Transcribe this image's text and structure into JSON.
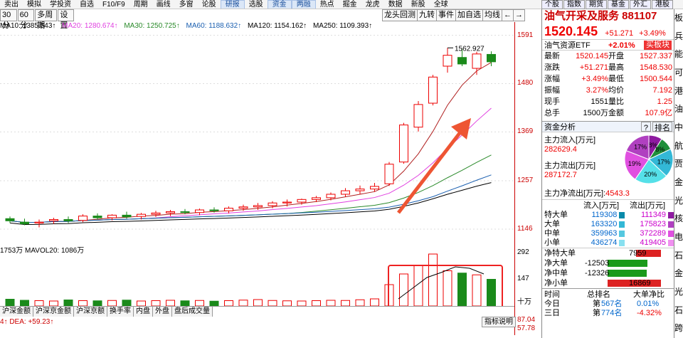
{
  "menu": [
    "卖出",
    "模拟",
    "学投资",
    "自选",
    "F10/F9",
    "周期",
    "画线",
    "多窗",
    "论股",
    "研报",
    "选股",
    "资金",
    "两融",
    "热点",
    "掘金",
    "龙虎",
    "数据",
    "新股",
    "全球"
  ],
  "menu_highlight": [
    "研报",
    "资金",
    "两融"
  ],
  "right_top_tabs": [
    "个股",
    "指数",
    "期货",
    "基金",
    "外汇",
    "港股"
  ],
  "period_tabs": [
    "30分",
    "60分",
    "多周期",
    "设置"
  ],
  "right_tools": [
    "龙头回测",
    "九转",
    "事件",
    "加自选",
    "均线",
    "←",
    "→"
  ],
  "ma": {
    "ma10": "MA10: 1385.543↑",
    "ma20": "MA20: 1280.674↑",
    "ma30": "MA30: 1250.725↑",
    "ma60": "MA60: 1188.632↑",
    "ma120": "MA120: 1154.162↑",
    "ma250": "MA250: 1109.393↑"
  },
  "price_ticks": [
    "1591",
    "1480",
    "1369",
    "1257",
    "1146"
  ],
  "high_label": "1562.927",
  "vol_header": "1753万  MAVOL20: 1086万",
  "vol_ticks": [
    "292",
    "147",
    "十万"
  ],
  "bottom_tabs": [
    "沪深金额",
    "沪深京金额",
    "沪深京额",
    "换手率",
    "内盘",
    "外盘",
    "盘后成交量"
  ],
  "macd_header": "4↑ DEA: +59.23↑",
  "macd_ticks": [
    "87.04",
    "57.78"
  ],
  "zb_btn": "指标说明",
  "stock": {
    "name": "油气开采及服务 881107",
    "price": "1520.145",
    "change": "+51.271",
    "pct": "+3.49%",
    "etf": "油气资源ETF",
    "etf_pct": "+2.01%",
    "buy": "买板块"
  },
  "quote": [
    {
      "k1": "最新",
      "v1": "1520.145",
      "k2": "开盘",
      "v2": "1527.337"
    },
    {
      "k1": "涨跌",
      "v1": "+51.271",
      "k2": "最高",
      "v2": "1548.530"
    },
    {
      "k1": "涨幅",
      "v1": "+3.49%",
      "k2": "最低",
      "v2": "1500.544"
    },
    {
      "k1": "振幅",
      "v1": "3.27%",
      "k2": "均价",
      "v2": "7.192"
    },
    {
      "k1": "现手",
      "v1": "1551",
      "k2": "量比",
      "v2": "1.25"
    },
    {
      "k1": "总手",
      "v1": "1500万",
      "k2": "金额",
      "v2": "107.9亿"
    }
  ],
  "fund": {
    "title": "资金分析",
    "help": "?",
    "rank": "排名",
    "inflow_label": "主力流入[万元]",
    "inflow": "282629.4",
    "outflow_label": "主力流出[万元]",
    "outflow": "287172.7",
    "net_label": "主力净流出[万元]:",
    "net": "4543.3",
    "pie": [
      {
        "label": "8%",
        "value": 8,
        "color": "#8e1aa0"
      },
      {
        "label": "8%",
        "value": 8,
        "color": "#1f8f3a"
      },
      {
        "label": "17%",
        "value": 17,
        "color": "#33b8d6"
      },
      {
        "label": "20%",
        "value": 20,
        "color": "#55e0e8"
      },
      {
        "label": "19%",
        "value": 19,
        "color": "#e050e0"
      },
      {
        "label": "17%",
        "value": 17,
        "color": "#b040c0"
      }
    ]
  },
  "flow_head": {
    "a": "流入[万元]",
    "b": "流出[万元]"
  },
  "flows": [
    {
      "k": "特大单",
      "in": "119308",
      "out": "111349"
    },
    {
      "k": "大单",
      "in": "163320",
      "out": "175823"
    },
    {
      "k": "中单",
      "in": "359963",
      "out": "372289"
    },
    {
      "k": "小单",
      "in": "436274",
      "out": "419405"
    }
  ],
  "nets": [
    {
      "k": "净特大单",
      "v": "7959",
      "pos": true,
      "w": 0.47
    },
    {
      "k": "净大单",
      "v": "-12503",
      "pos": false,
      "w": 0.74
    },
    {
      "k": "净中单",
      "v": "-12326",
      "pos": false,
      "w": 0.73
    },
    {
      "k": "净小单",
      "v": "16869",
      "pos": true,
      "w": 1.0
    }
  ],
  "rank_head": {
    "a": "时间",
    "b": "总排名",
    "c": "大单净比"
  },
  "ranks": [
    {
      "k": "今日",
      "b": "第",
      "n": "567名",
      "c": "0.01%"
    },
    {
      "k": "三日",
      "b": "第",
      "n": "774名",
      "c": "-4.32%"
    }
  ],
  "far_right": [
    "板",
    "兵",
    "能",
    "可",
    "港",
    "油",
    "中",
    "航",
    "贾",
    "金",
    "光",
    "核",
    "电",
    "石",
    "金",
    "光",
    "石",
    "跨"
  ],
  "chart_data": {
    "type": "candlestick",
    "ylim": [
      1110,
      1600
    ],
    "candles": [
      [
        1170,
        1175,
        1160,
        1165
      ],
      [
        1162,
        1170,
        1155,
        1158
      ],
      [
        1160,
        1168,
        1150,
        1162
      ],
      [
        1165,
        1172,
        1158,
        1168
      ],
      [
        1168,
        1175,
        1160,
        1165
      ],
      [
        1166,
        1180,
        1162,
        1176
      ],
      [
        1176,
        1182,
        1168,
        1172
      ],
      [
        1172,
        1180,
        1166,
        1178
      ],
      [
        1178,
        1186,
        1170,
        1174
      ],
      [
        1175,
        1183,
        1168,
        1180
      ],
      [
        1180,
        1188,
        1174,
        1183
      ],
      [
        1183,
        1190,
        1176,
        1186
      ],
      [
        1186,
        1192,
        1180,
        1184
      ],
      [
        1184,
        1193,
        1178,
        1190
      ],
      [
        1190,
        1196,
        1184,
        1188
      ],
      [
        1188,
        1198,
        1182,
        1194
      ],
      [
        1194,
        1202,
        1188,
        1197
      ],
      [
        1197,
        1206,
        1190,
        1200
      ],
      [
        1200,
        1210,
        1194,
        1206
      ],
      [
        1206,
        1214,
        1198,
        1208
      ],
      [
        1208,
        1216,
        1202,
        1214
      ],
      [
        1214,
        1222,
        1208,
        1218
      ],
      [
        1218,
        1230,
        1212,
        1226
      ],
      [
        1226,
        1240,
        1220,
        1234
      ],
      [
        1234,
        1246,
        1226,
        1238
      ],
      [
        1238,
        1252,
        1232,
        1244
      ],
      [
        1250,
        1300,
        1245,
        1295
      ],
      [
        1300,
        1390,
        1296,
        1385
      ],
      [
        1380,
        1440,
        1370,
        1432
      ],
      [
        1435,
        1500,
        1430,
        1495
      ],
      [
        1520,
        1562,
        1505,
        1545
      ],
      [
        1540,
        1560,
        1520,
        1525
      ],
      [
        1515,
        1553,
        1500,
        1548
      ],
      [
        1547,
        1554,
        1520,
        1530
      ]
    ],
    "volumes": [
      38,
      32,
      30,
      28,
      34,
      30,
      29,
      31,
      33,
      28,
      30,
      32,
      29,
      31,
      27,
      30,
      33,
      36,
      31,
      29,
      28,
      30,
      32,
      31,
      35,
      40,
      120,
      180,
      230,
      292,
      198,
      185,
      175,
      150
    ]
  }
}
